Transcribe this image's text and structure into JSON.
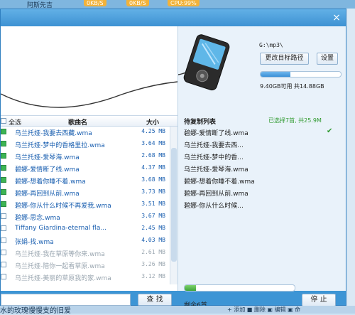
{
  "background": {
    "top_title": "阿斯先吉",
    "speed_1": "0KB/S",
    "speed_2": "0KB/S",
    "cpu": "CPU:99%",
    "bottom_text": "水的玫瑰慢慢支的旧爱",
    "bottom_actions": "+ 添加  ■ 删除  ▣ 编辑  ▣ 命"
  },
  "window": {
    "close_label": "×"
  },
  "device": {
    "path": "G:\\mp3\\",
    "change_path_label": "更改目标路径",
    "settings_label": "设置",
    "storage_text": "9.40GB可用 共14.88GB",
    "storage_used_fraction": 0.37
  },
  "song_list": {
    "header_select_all": "全选",
    "header_name": "歌曲名",
    "header_size": "大小",
    "rows": [
      {
        "name": "乌兰托娅-我要去西藏.wma",
        "size": "4.25 MB",
        "checked": true,
        "grey": false
      },
      {
        "name": "乌兰托娅-梦中的香格里拉.wma",
        "size": "3.64 MB",
        "checked": true,
        "grey": false
      },
      {
        "name": "乌兰托娅-爱琴海.wma",
        "size": "2.68 MB",
        "checked": true,
        "grey": false
      },
      {
        "name": "碧娜-爱情断了线.wma",
        "size": "4.37 MB",
        "checked": true,
        "grey": false
      },
      {
        "name": "碧娜-想着你睡不着.wma",
        "size": "3.68 MB",
        "checked": true,
        "grey": false
      },
      {
        "name": "碧娜-再回到从前.wma",
        "size": "3.73 MB",
        "checked": true,
        "grey": false
      },
      {
        "name": "碧娜-你从什么时候不再爱我.wma",
        "size": "3.51 MB",
        "checked": true,
        "grey": false
      },
      {
        "name": "碧娜-思念.wma",
        "size": "3.67 MB",
        "checked": false,
        "grey": false
      },
      {
        "name": "Tiffany Giardina-eternal fla...",
        "size": "2.45 MB",
        "checked": false,
        "grey": false
      },
      {
        "name": "张娟-找.wma",
        "size": "4.03 MB",
        "checked": false,
        "grey": false
      },
      {
        "name": "乌兰托娅-我在草原等你来.wma",
        "size": "2.61 MB",
        "checked": false,
        "grey": true
      },
      {
        "name": "乌兰托娅-陪你一起看草原.wma",
        "size": "3.26 MB",
        "checked": false,
        "grey": true
      },
      {
        "name": "乌兰托娅-美丽的草原我的家.wma",
        "size": "3.12 MB",
        "checked": false,
        "grey": true
      }
    ],
    "search_label": "查 找"
  },
  "queue": {
    "title": "待复制列表",
    "selected_text": "已选择7首, 共25.9M",
    "items": [
      "碧娜-爱情断了线.wma",
      "乌兰托娅-我要去西...",
      "乌兰托娅-梦中的香...",
      "乌兰托娅-爱琴海.wma",
      "碧娜-想着你睡不着.wma",
      "碧娜-再回到从前.wma",
      "碧娜-你从什么时候..."
    ],
    "check_mark": "✔",
    "progress_fraction": 0.1,
    "remaining_text": "剩余6首",
    "stop_label": "停 止"
  },
  "colors": {
    "accent": "#3d95d5",
    "link_text": "#1a5fb0",
    "selected_green": "#2f9a2f"
  }
}
